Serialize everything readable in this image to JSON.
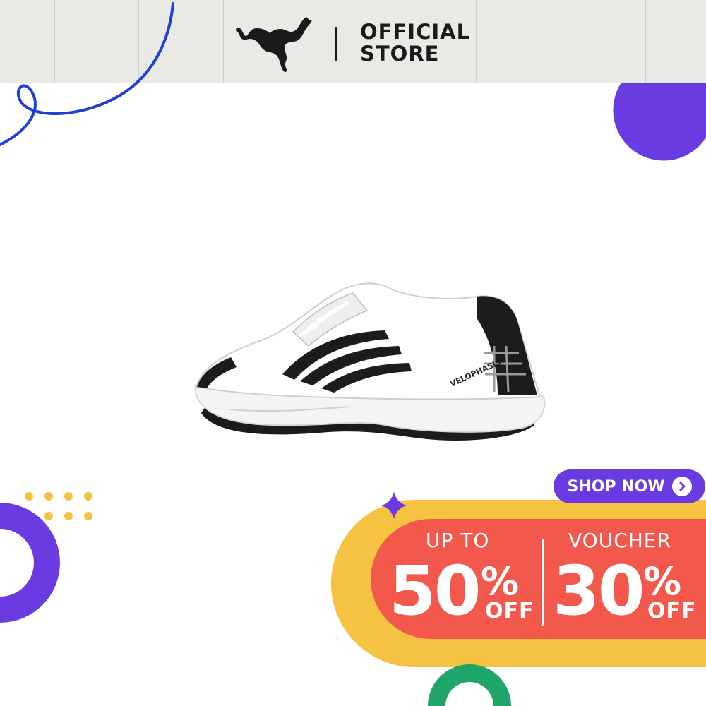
{
  "header": {
    "brand": "PUMA",
    "store_line1": "OFFICIAL",
    "store_line2": "STORE"
  },
  "product": {
    "model_text": "VELOPHASIS"
  },
  "cta": {
    "shop_now_label": "SHOP NOW",
    "arrow_icon": "chevron-right-icon"
  },
  "promo": {
    "left": {
      "label": "UP TO",
      "value": "50",
      "percent": "%",
      "suffix": "OFF"
    },
    "right": {
      "label": "VOUCHER",
      "value": "30",
      "percent": "%",
      "suffix": "OFF"
    }
  },
  "colors": {
    "header_bg": "#e9e9e6",
    "purple": "#6a3be0",
    "blue_line": "#1f3fd8",
    "promo_red": "#f3584c",
    "promo_yellow": "#f5c242",
    "green": "#1fa46a",
    "dot_yellow": "#f5c242"
  }
}
